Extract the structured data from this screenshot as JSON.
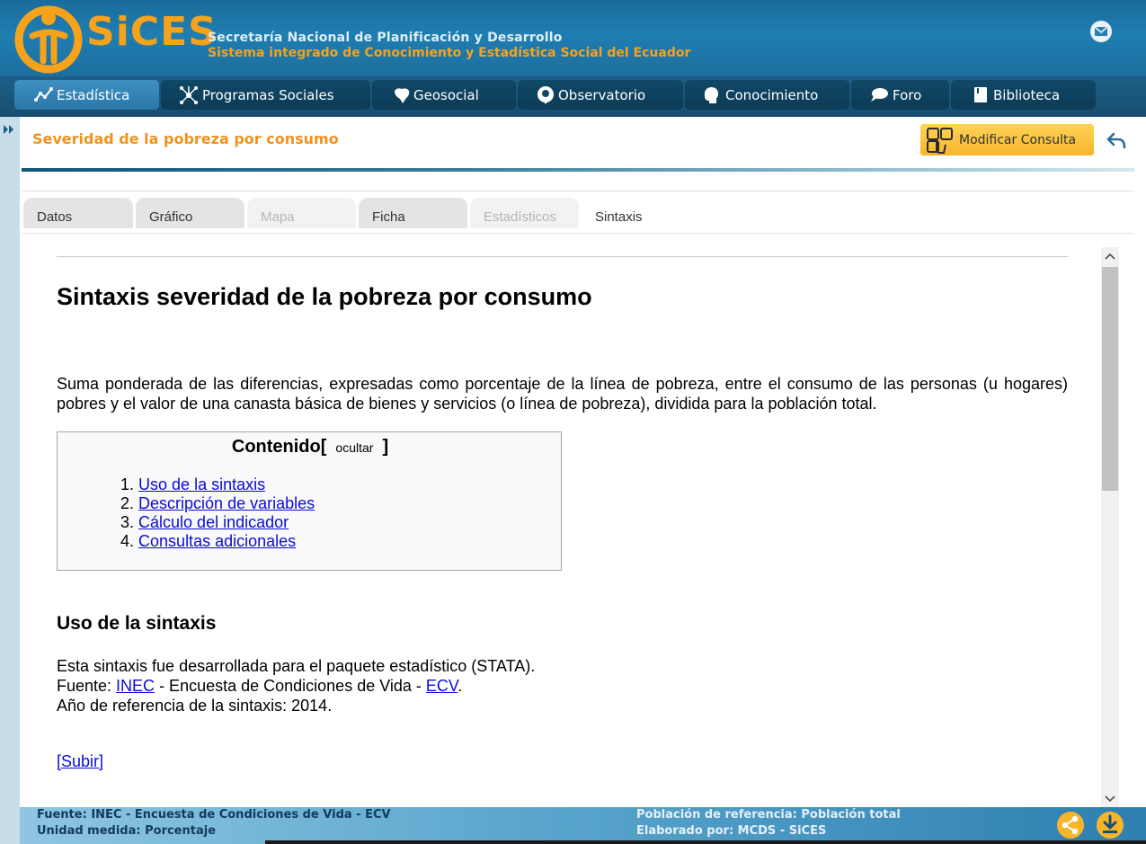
{
  "app": {
    "logo_text": "SiCES",
    "org_line1": "Secretaría Nacional de Planificación y Desarrollo",
    "org_line2": "Sistema integrado de Conocimiento y Estadística Social del Ecuador"
  },
  "nav": {
    "items": [
      {
        "label": "Estadística",
        "icon": "chart-line-icon",
        "active": true
      },
      {
        "label": "Programas Sociales",
        "icon": "network-icon",
        "active": false
      },
      {
        "label": "Geosocial",
        "icon": "map-icon",
        "active": false
      },
      {
        "label": "Observatorio",
        "icon": "location-pin-icon",
        "active": false
      },
      {
        "label": "Conocimiento",
        "icon": "head-icon",
        "active": false
      },
      {
        "label": "Foro",
        "icon": "chat-icon",
        "active": false
      },
      {
        "label": "Biblioteca",
        "icon": "book-icon",
        "active": false
      }
    ]
  },
  "page": {
    "title": "Severidad de la pobreza por consumo",
    "modify_button": "Modificar Consulta"
  },
  "tabs": [
    {
      "label": "Datos",
      "state": "normal"
    },
    {
      "label": "Gráfico",
      "state": "normal"
    },
    {
      "label": "Mapa",
      "state": "disabled"
    },
    {
      "label": "Ficha",
      "state": "normal"
    },
    {
      "label": "Estadísticos",
      "state": "disabled"
    },
    {
      "label": "Sintaxis",
      "state": "active"
    }
  ],
  "content": {
    "heading": "Sintaxis severidad de la pobreza por consumo",
    "description": "Suma ponderada de las diferencias, expresadas como porcentaje de la línea de pobreza, entre el consumo de las personas (u hogares) pobres y el valor de una canasta básica de bienes y servicios (o línea de pobreza), dividida para la población total.",
    "toc": {
      "title": "Contenido",
      "bracket_open": "[",
      "bracket_close": "]",
      "toggle": "ocultar",
      "items": [
        {
          "number": "1.",
          "label": "Uso de la sintaxis"
        },
        {
          "number": "2.",
          "label": "Descripción de variables"
        },
        {
          "number": "3.",
          "label": "Cálculo del indicador"
        },
        {
          "number": "4.",
          "label": "Consultas adicionales"
        }
      ]
    },
    "section": {
      "title": "Uso de la sintaxis",
      "line1": "Esta sintaxis fue desarrollada para el paquete estadístico (STATA).",
      "line2_prefix": "Fuente: ",
      "line2_link1": "INEC",
      "line2_middle": " - Encuesta de Condiciones de Vida - ",
      "line2_link2": "ECV",
      "line2_suffix": ".",
      "line3": "Año de referencia de la sintaxis: 2014."
    },
    "subir": "[Subir]"
  },
  "footer": {
    "fuente": "Fuente: INEC - Encuesta de Condiciones de Vida - ECV",
    "unidad": "Unidad medida: Porcentaje",
    "poblacion": "Población de referencia: Población total",
    "elaborado": "Elaborado por: MCDS - SiCES"
  },
  "colors": {
    "brand_orange": "#f7a21b",
    "header_blue": "#1f7eb1",
    "nav_dark": "#0f4866",
    "nav_active": "#3e8fc2",
    "title_orange": "#f0921e",
    "link_blue": "#0b0bd6"
  }
}
